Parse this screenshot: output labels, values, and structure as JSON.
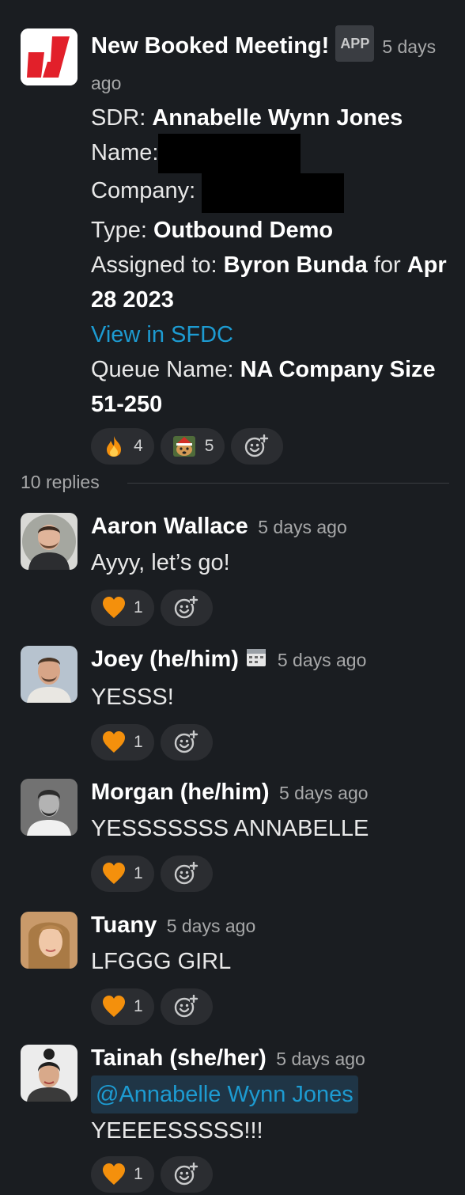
{
  "bot_post": {
    "author": "New Booked Meeting!",
    "badge": "APP",
    "ts_part1": "5 days",
    "ts_part2": "ago",
    "sdr_label": "SDR: ",
    "sdr_value": "Annabelle Wynn Jones",
    "name_label": "Name:",
    "company_label": "Company:",
    "type_label": "Type: ",
    "type_value": "Outbound Demo",
    "assigned_label": "Assigned to: ",
    "assigned_value": "Byron Bunda",
    "for_word": " for ",
    "date_part1": "Apr",
    "date_part2": "28 2023",
    "link": "View in SFDC",
    "queue_label": "Queue Name: ",
    "queue_value_part1": "NA Company Size",
    "queue_value_part2": "51-250",
    "reactions": [
      {
        "icon": "fire-emoji-icon",
        "count": "4"
      },
      {
        "icon": "dog-santa-hat-emoji-icon",
        "count": "5"
      }
    ]
  },
  "thread": {
    "replies_label": "10 replies"
  },
  "replies": [
    {
      "author": "Aaron Wallace",
      "ts": "5 days ago",
      "text": "Ayyy, let’s go!",
      "reaction_count": "1"
    },
    {
      "author": "Joey (he/him)",
      "ts": "5 days ago",
      "text": "YESSS!",
      "reaction_count": "1",
      "status_icon": "calendar-icon"
    },
    {
      "author": "Morgan (he/him)",
      "ts": "5 days ago",
      "text": "YESSSSSSS ANNABELLE",
      "reaction_count": "1"
    },
    {
      "author": "Tuany",
      "ts": "5 days ago",
      "text": "LFGGG GIRL",
      "reaction_count": "1"
    },
    {
      "author": "Tainah (she/her)",
      "ts": "5 days ago",
      "mention": "@Annabelle Wynn Jones",
      "text": "YEEEESSSSS!!!",
      "reaction_count": "1"
    }
  ],
  "colors": {
    "background": "#1a1d21",
    "link": "#1d9bd1",
    "reaction_bg": "#2b2d31",
    "orange_heart": "#f4900c"
  }
}
